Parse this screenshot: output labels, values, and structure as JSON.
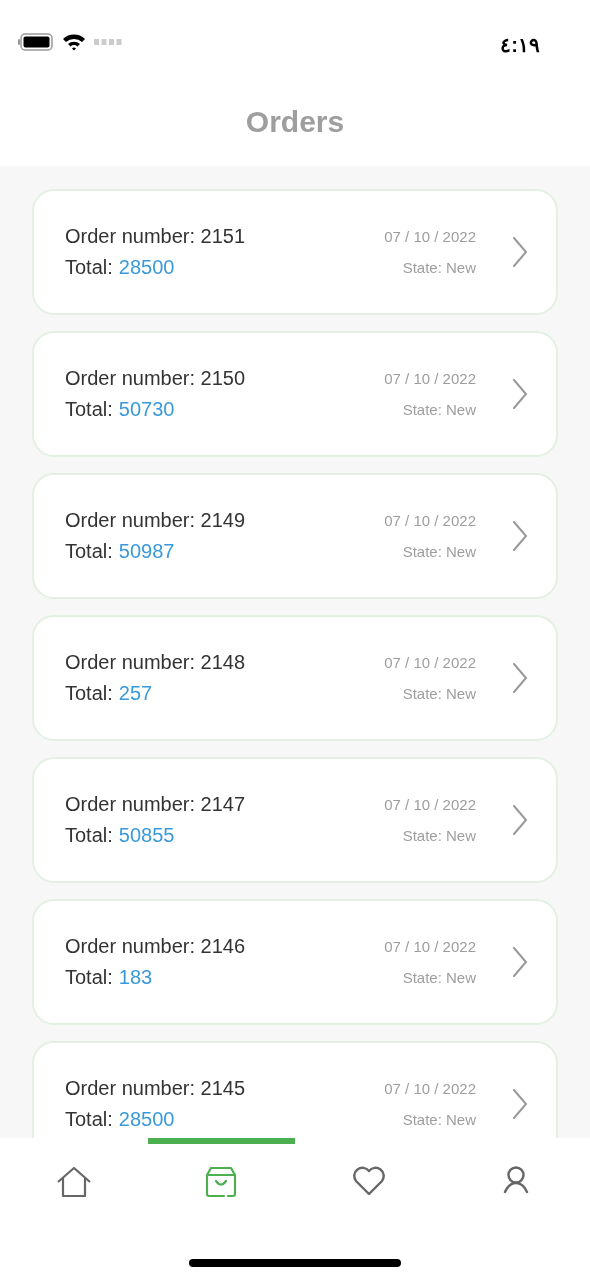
{
  "status_bar": {
    "time": "٤:١٩"
  },
  "header": {
    "title": "Orders"
  },
  "orders": [
    {
      "number_label": "Order number: 2151",
      "total_label": "Total:",
      "total": "28500",
      "date": "07 / 10 / 2022",
      "state": "State: New"
    },
    {
      "number_label": "Order number: 2150",
      "total_label": "Total:",
      "total": "50730",
      "date": "07 / 10 / 2022",
      "state": "State: New"
    },
    {
      "number_label": "Order number: 2149",
      "total_label": "Total:",
      "total": "50987",
      "date": "07 / 10 / 2022",
      "state": "State: New"
    },
    {
      "number_label": "Order number: 2148",
      "total_label": "Total:",
      "total": "257",
      "date": "07 / 10 / 2022",
      "state": "State: New"
    },
    {
      "number_label": "Order number: 2147",
      "total_label": "Total:",
      "total": "50855",
      "date": "07 / 10 / 2022",
      "state": "State: New"
    },
    {
      "number_label": "Order number: 2146",
      "total_label": "Total:",
      "total": "183",
      "date": "07 / 10 / 2022",
      "state": "State: New"
    },
    {
      "number_label": "Order number: 2145",
      "total_label": "Total:",
      "total": "28500",
      "date": "07 / 10 / 2022",
      "state": "State: New"
    }
  ],
  "tab_bar": [
    {
      "kind": "home",
      "selected": false
    },
    {
      "kind": "orders",
      "selected": true
    },
    {
      "kind": "favorites",
      "selected": false
    },
    {
      "kind": "profile",
      "selected": false
    }
  ]
}
